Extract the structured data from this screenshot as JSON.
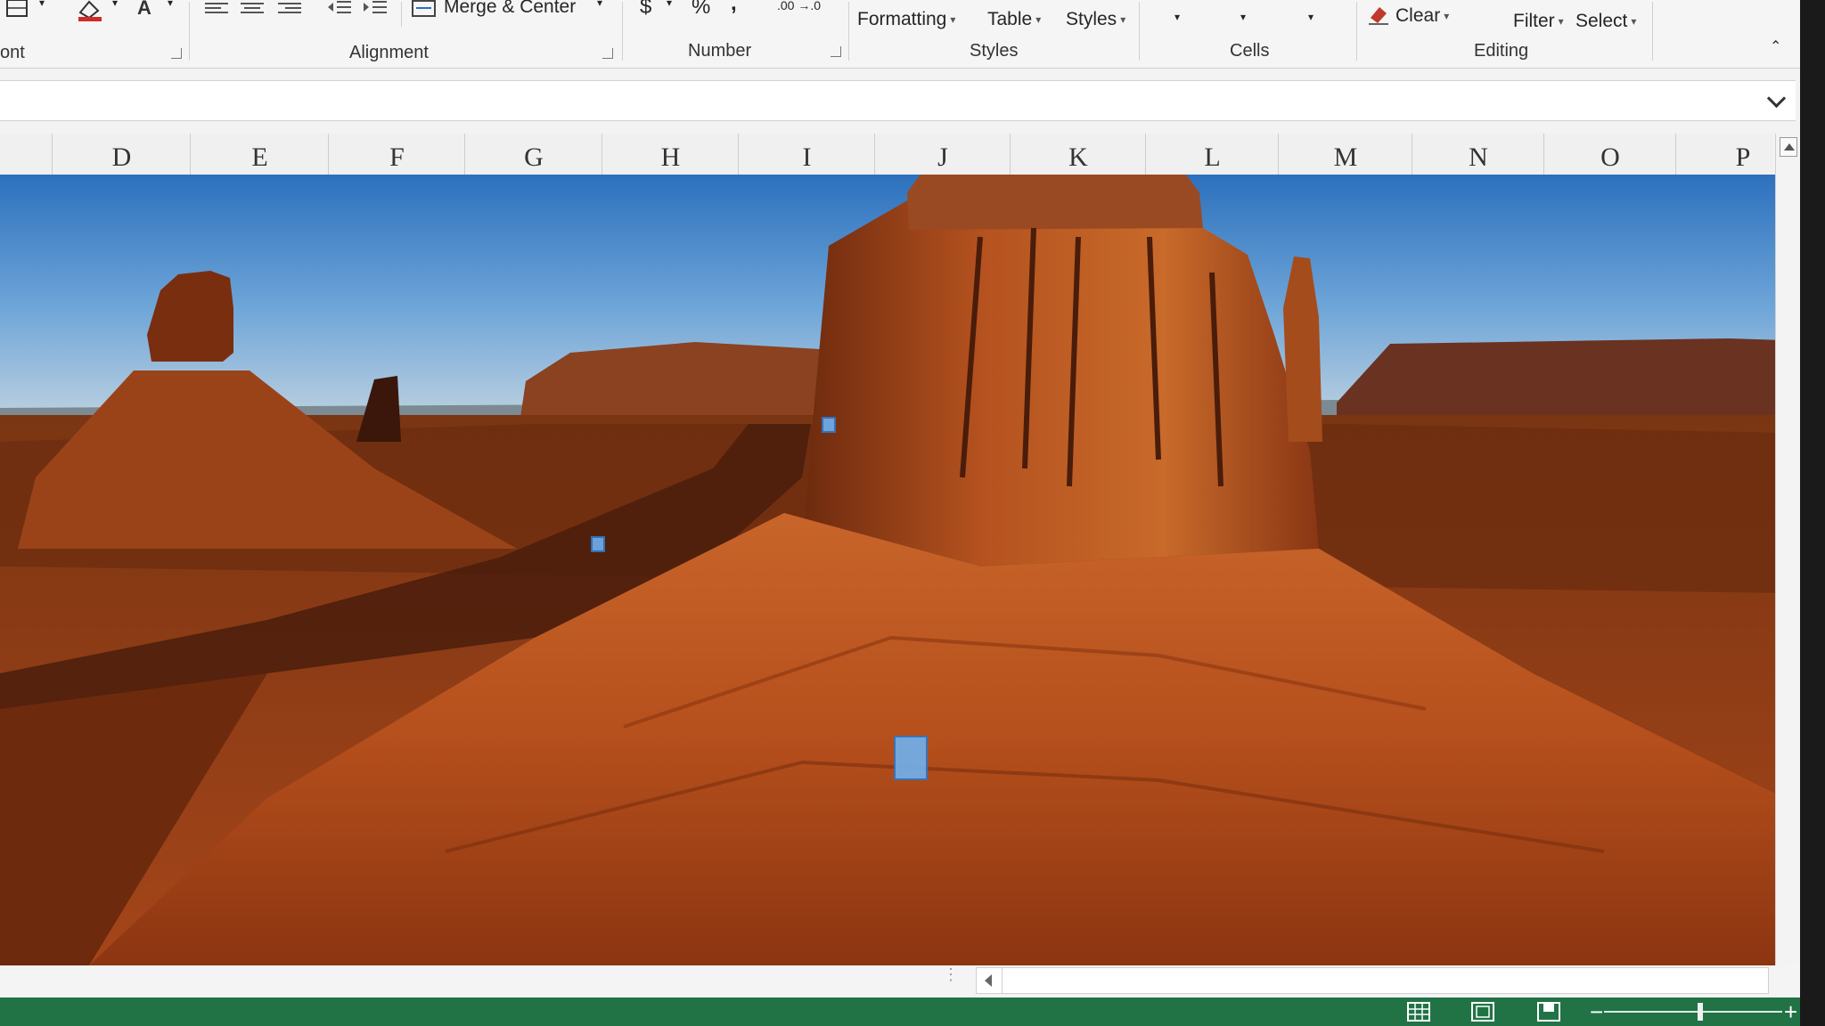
{
  "ribbon": {
    "merge_center": "Merge & Center",
    "currency_symbol": "$",
    "percent_symbol": "%",
    "comma_symbol": ",",
    "increase_decimal": ".00 →.0",
    "conditional_formatting": "Formatting",
    "format_as_table": "Table",
    "cell_styles": "Styles",
    "clear": "Clear",
    "filter": "Filter",
    "select": "Select",
    "groups": {
      "font": "ont",
      "alignment": "Alignment",
      "number": "Number",
      "styles": "Styles",
      "cells": "Cells",
      "editing": "Editing"
    }
  },
  "columns": [
    "D",
    "E",
    "F",
    "G",
    "H",
    "I",
    "J",
    "K",
    "L",
    "M",
    "N",
    "O",
    "P"
  ],
  "picture": {
    "subject": "desert butte landscape",
    "sky_color": "#3a7dc4",
    "rock_color": "#a8461a"
  },
  "status": {
    "accent": "#217346",
    "views": [
      "normal-view-icon",
      "page-layout-icon",
      "page-break-preview-icon"
    ]
  }
}
